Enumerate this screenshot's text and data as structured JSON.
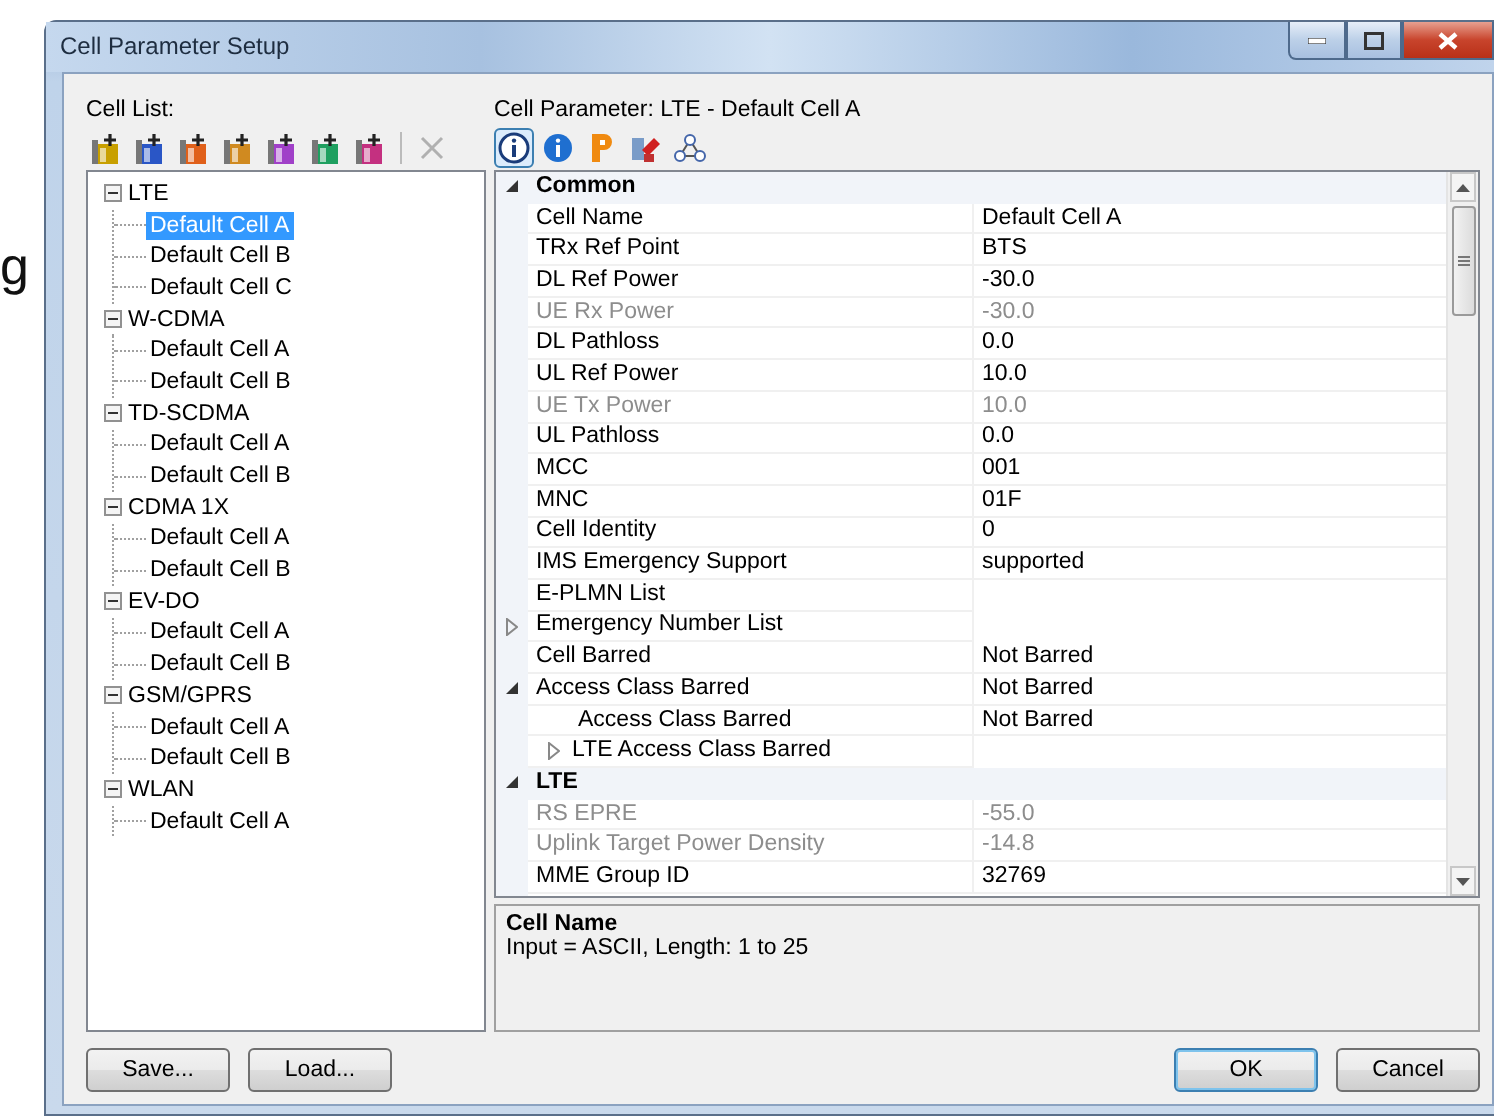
{
  "background_text": "g",
  "window": {
    "title": "Cell Parameter Setup"
  },
  "cell_list": {
    "label": "Cell List:",
    "toolbar": [
      {
        "kind": "add",
        "color": "#c8a000",
        "disabled": false
      },
      {
        "kind": "add",
        "color": "#2a56c6",
        "disabled": false
      },
      {
        "kind": "add",
        "color": "#e0601a",
        "disabled": false
      },
      {
        "kind": "add",
        "color": "#d08a20",
        "disabled": false
      },
      {
        "kind": "add",
        "color": "#a040c8",
        "disabled": false
      },
      {
        "kind": "add",
        "color": "#1fa060",
        "disabled": false
      },
      {
        "kind": "add",
        "color": "#c43080",
        "disabled": false
      },
      {
        "kind": "delete",
        "disabled": true
      }
    ],
    "tree": [
      {
        "label": "LTE",
        "expanded": true,
        "children": [
          {
            "label": "Default Cell A",
            "selected": true
          },
          {
            "label": "Default Cell B",
            "selected": false
          },
          {
            "label": "Default Cell C",
            "selected": false
          }
        ]
      },
      {
        "label": "W-CDMA",
        "expanded": true,
        "children": [
          {
            "label": "Default Cell A",
            "selected": false
          },
          {
            "label": "Default Cell B",
            "selected": false
          }
        ]
      },
      {
        "label": "TD-SCDMA",
        "expanded": true,
        "children": [
          {
            "label": "Default Cell A",
            "selected": false
          },
          {
            "label": "Default Cell B",
            "selected": false
          }
        ]
      },
      {
        "label": "CDMA 1X",
        "expanded": true,
        "children": [
          {
            "label": "Default Cell A",
            "selected": false
          },
          {
            "label": "Default Cell B",
            "selected": false
          }
        ]
      },
      {
        "label": "EV-DO",
        "expanded": true,
        "children": [
          {
            "label": "Default Cell A",
            "selected": false
          },
          {
            "label": "Default Cell B",
            "selected": false
          }
        ]
      },
      {
        "label": "GSM/GPRS",
        "expanded": true,
        "children": [
          {
            "label": "Default Cell A",
            "selected": false
          },
          {
            "label": "Default Cell B",
            "selected": false
          }
        ]
      },
      {
        "label": "WLAN",
        "expanded": true,
        "children": [
          {
            "label": "Default Cell A",
            "selected": false
          }
        ]
      }
    ]
  },
  "cell_parameter": {
    "label": "Cell Parameter: LTE - Default Cell A",
    "toolbar": [
      {
        "kind": "info-outline",
        "selected": true
      },
      {
        "kind": "info",
        "selected": false
      },
      {
        "kind": "letter-p",
        "selected": false
      },
      {
        "kind": "paint",
        "selected": false
      },
      {
        "kind": "network",
        "selected": false
      }
    ],
    "grid": [
      {
        "kind": "category",
        "name": "Common",
        "expanded": true,
        "children": [
          {
            "kind": "property",
            "name": "Cell Name",
            "value": "Default Cell A",
            "disabled": false
          },
          {
            "kind": "property",
            "name": "TRx Ref Point",
            "value": "BTS",
            "disabled": false
          },
          {
            "kind": "property",
            "name": "DL Ref Power",
            "value": "-30.0",
            "disabled": false
          },
          {
            "kind": "property",
            "name": "UE Rx Power",
            "value": "-30.0",
            "disabled": true
          },
          {
            "kind": "property",
            "name": "DL Pathloss",
            "value": "0.0",
            "disabled": false
          },
          {
            "kind": "property",
            "name": "UL Ref Power",
            "value": "10.0",
            "disabled": false
          },
          {
            "kind": "property",
            "name": "UE Tx Power",
            "value": "10.0",
            "disabled": true
          },
          {
            "kind": "property",
            "name": "UL Pathloss",
            "value": "0.0",
            "disabled": false
          },
          {
            "kind": "property",
            "name": "MCC",
            "value": "001",
            "disabled": false
          },
          {
            "kind": "property",
            "name": "MNC",
            "value": "01F",
            "disabled": false
          },
          {
            "kind": "property",
            "name": "Cell Identity",
            "value": "0",
            "disabled": false
          },
          {
            "kind": "property",
            "name": "IMS Emergency Support",
            "value": "supported",
            "disabled": false
          },
          {
            "kind": "property",
            "name": "E-PLMN List",
            "disabled": false
          },
          {
            "kind": "property",
            "name": "Emergency Number List",
            "disabled": false,
            "expanded": false
          },
          {
            "kind": "property",
            "name": "Cell Barred",
            "value": "Not Barred",
            "disabled": false
          },
          {
            "kind": "property",
            "name": "Access Class Barred",
            "value": "Not Barred",
            "disabled": false,
            "expanded": true,
            "children": [
              {
                "kind": "property",
                "name": "Access Class Barred",
                "value": "Not Barred",
                "disabled": false
              },
              {
                "kind": "property",
                "name": "LTE Access Class Barred",
                "disabled": false,
                "expanded": false
              }
            ]
          }
        ]
      },
      {
        "kind": "category",
        "name": "LTE",
        "expanded": true,
        "children": [
          {
            "kind": "property",
            "name": "RS EPRE",
            "value": "-55.0",
            "disabled": true
          },
          {
            "kind": "property",
            "name": "Uplink Target Power Density",
            "value": "-14.8",
            "disabled": true
          },
          {
            "kind": "property",
            "name": "MME Group ID",
            "value": "32769",
            "disabled": false
          }
        ]
      }
    ],
    "description": {
      "title": "Cell Name",
      "text": "Input = ASCII, Length: 1 to 25"
    }
  },
  "buttons": {
    "left": [
      {
        "label": "Save...",
        "default": false
      },
      {
        "label": "Load...",
        "default": false
      }
    ],
    "right": [
      {
        "label": "OK",
        "default": true
      },
      {
        "label": "Cancel",
        "default": false
      }
    ]
  }
}
